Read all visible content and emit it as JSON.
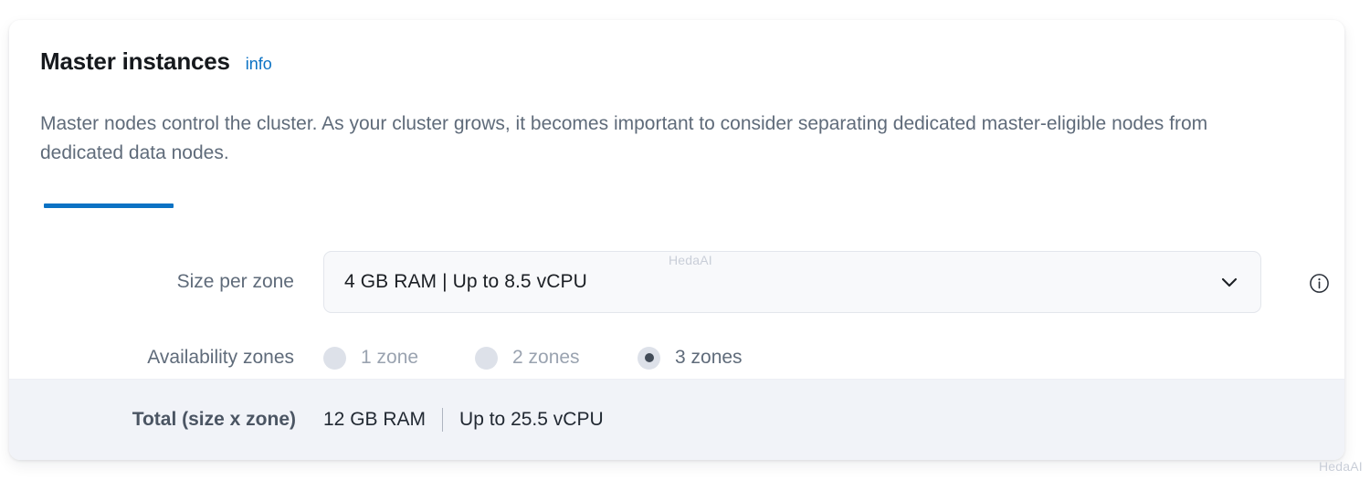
{
  "card": {
    "title": "Master instances",
    "info_link": "info",
    "description": "Master nodes control the cluster. As your cluster grows, it becomes important to consider separating dedicated master-eligible nodes from dedicated data nodes.",
    "accent_color": "#0b72c4"
  },
  "fields": {
    "size_per_zone": {
      "label": "Size per zone",
      "value": "4 GB RAM | Up to 8.5 vCPU",
      "chevron_icon": "chevron-down-icon",
      "help_icon": "info-circle-icon"
    },
    "availability_zones": {
      "label": "Availability zones",
      "options": [
        {
          "label": "1 zone",
          "selected": false
        },
        {
          "label": "2 zones",
          "selected": false
        },
        {
          "label": "3 zones",
          "selected": true
        }
      ]
    }
  },
  "footer": {
    "label": "Total (size x zone)",
    "ram": "12 GB RAM",
    "cpu": "Up to 25.5 vCPU"
  },
  "watermarks": {
    "top": "HedaAI",
    "bottom": "HedaAI"
  }
}
